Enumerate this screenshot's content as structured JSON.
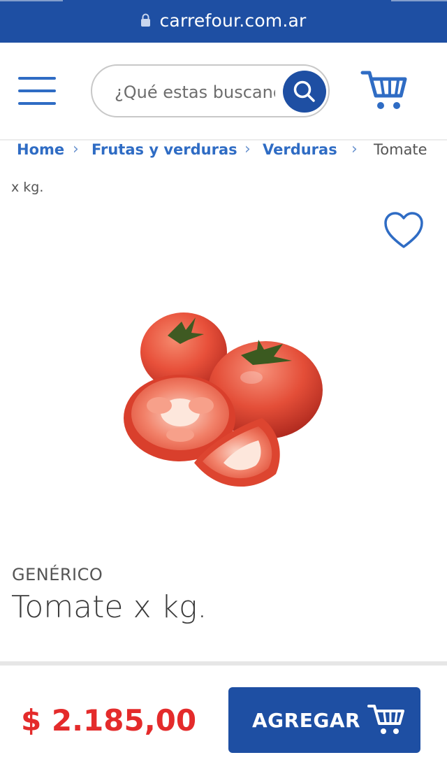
{
  "browser": {
    "url": "carrefour.com.ar"
  },
  "header": {
    "search_placeholder": "¿Qué estas buscando?"
  },
  "breadcrumb": {
    "items": [
      "Home",
      "Frutas y verduras",
      "Verduras"
    ],
    "current_line1": "Tomate",
    "current_line2": "x kg."
  },
  "product": {
    "brand": "GENÉRICO",
    "title": "Tomate x kg.",
    "price": "$ 2.185,00"
  },
  "actions": {
    "add_label": "AGREGAR"
  },
  "colors": {
    "brand_blue": "#1e4fa3",
    "link_blue": "#2f6cc4",
    "price_red": "#e42b2b"
  },
  "icons": [
    "lock-icon",
    "menu-icon",
    "search-icon",
    "cart-icon",
    "heart-icon",
    "chevron-right-icon"
  ]
}
